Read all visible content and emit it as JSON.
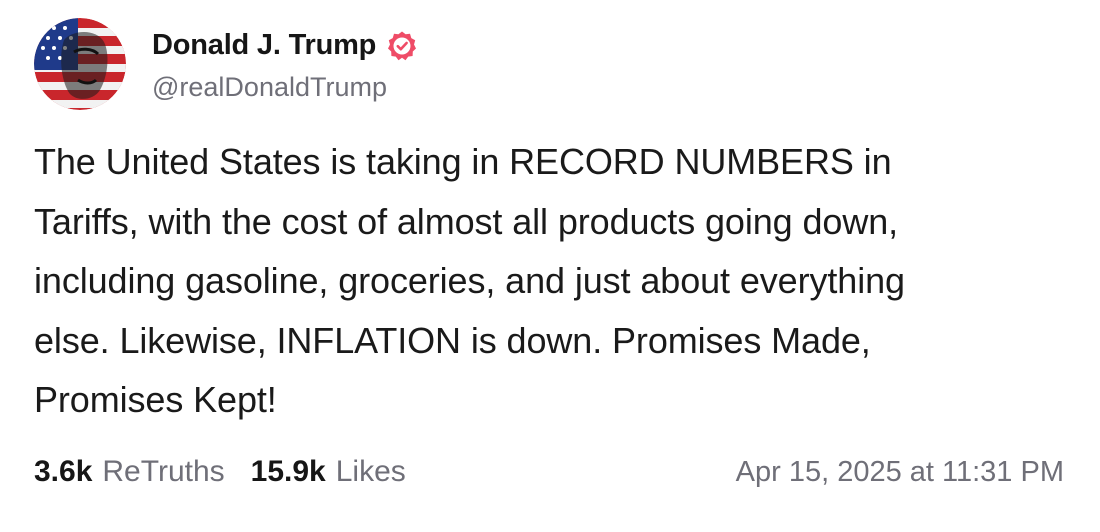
{
  "author": {
    "display_name": "Donald J. Trump",
    "handle": "@realDonaldTrump",
    "verified": true,
    "avatar_icon": "profile-avatar-flag-portrait",
    "verified_icon": "verified-badge-icon",
    "verified_color": "#ef4c67"
  },
  "post": {
    "lines": [
      "The United States is taking in RECORD NUMBERS in",
      "Tariffs, with the cost of almost all products going down,",
      "including gasoline, groceries, and just about everything",
      "else. Likewise, INFLATION is down. Promises Made,",
      "Promises Kept!"
    ]
  },
  "stats": {
    "retruths_count": "3.6k",
    "retruths_label": "ReTruths",
    "likes_count": "15.9k",
    "likes_label": "Likes"
  },
  "timestamp": "Apr 15, 2025 at 11:31 PM",
  "colors": {
    "text_primary": "#161616",
    "text_secondary": "#6f6f78",
    "background": "#ffffff"
  }
}
